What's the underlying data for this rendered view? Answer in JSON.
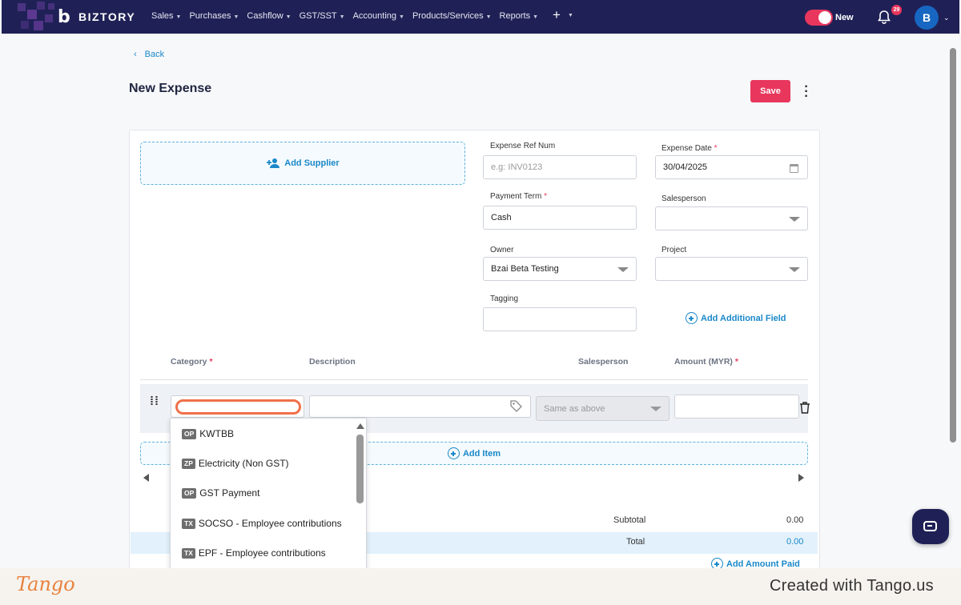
{
  "app": {
    "logo_text": "BIZTORY"
  },
  "nav": {
    "items": [
      "Sales",
      "Purchases",
      "Cashflow",
      "GST/SST",
      "Accounting",
      "Products/Services",
      "Reports"
    ],
    "plus": "+"
  },
  "header": {
    "toggle_label": "New",
    "notification_count": "29",
    "avatar_initial": "B"
  },
  "page": {
    "back_label": "Back",
    "title": "New Expense",
    "save_label": "Save"
  },
  "supplier": {
    "add_label": "Add Supplier"
  },
  "fields": {
    "expense_ref_label": "Expense Ref Num",
    "expense_ref_placeholder": "e.g: INV0123",
    "expense_date_label": "Expense Date",
    "expense_date_value": "30/04/2025",
    "payment_term_label": "Payment Term",
    "payment_term_value": "Cash",
    "salesperson_label": "Salesperson",
    "owner_label": "Owner",
    "owner_value": "Bzai Beta Testing",
    "project_label": "Project",
    "tagging_label": "Tagging",
    "add_field_label": "Add Additional Field",
    "required_mark": "*"
  },
  "table": {
    "headers": {
      "category": "Category",
      "description": "Description",
      "salesperson": "Salesperson",
      "amount": "Amount (MYR)"
    },
    "salesperson_placeholder": "Same as above",
    "add_item_label": "Add Item"
  },
  "category_options": [
    {
      "code": "OP",
      "label": "KWTBB"
    },
    {
      "code": "ZP",
      "label": "Electricity (Non GST)"
    },
    {
      "code": "OP",
      "label": "GST Payment"
    },
    {
      "code": "TX",
      "label": "SOCSO - Employee contributions"
    },
    {
      "code": "TX",
      "label": "EPF - Employee contributions"
    }
  ],
  "totals": {
    "subtotal_label": "Subtotal",
    "subtotal_value": "0.00",
    "total_label": "Total",
    "total_value": "0.00",
    "add_paid_label": "Add Amount Paid"
  },
  "footer": {
    "logo": "Tango",
    "credit": "Created with Tango.us"
  },
  "colors": {
    "primary": "#1f2156",
    "accent": "#e8365d",
    "link": "#1a88c9",
    "highlight": "#f0704a"
  }
}
